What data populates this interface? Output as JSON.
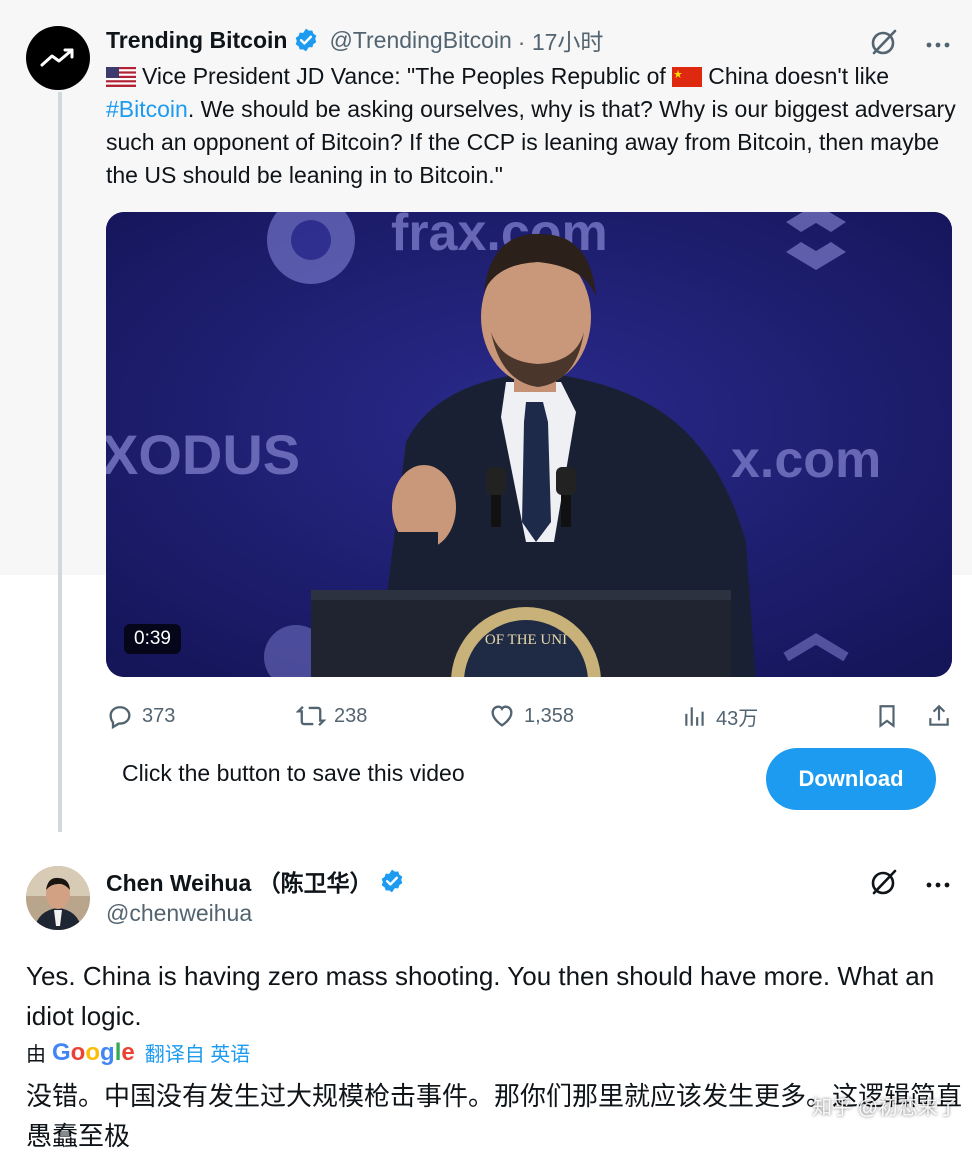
{
  "tweet": {
    "display_name": "Trending Bitcoin",
    "handle": "@TrendingBitcoin",
    "time": "· 17小时",
    "text_part1": "Vice President JD Vance: \"The Peoples Republic of ",
    "text_part2": "China doesn't like ",
    "hashtag": "#Bitcoin",
    "text_part3": ". We should be asking ourselves, why is that? Why is our biggest adversary such an opponent of Bitcoin? If the CCP is leaning away from Bitcoin, then maybe the US should be leaning in to Bitcoin.\"",
    "video_duration": "0:39",
    "video_backdrop": {
      "brand_1": "frax.com",
      "brand_2": "XODUS",
      "brand_3": "x.com",
      "seal_text": "OF THE UNI"
    },
    "actions": {
      "replies": "373",
      "retweets": "238",
      "likes": "1,358",
      "views": "43万"
    }
  },
  "save_bar": {
    "text": "Click the button to save this video",
    "button": "Download"
  },
  "reply": {
    "display_name": "Chen Weihua （陈卫华）",
    "handle": "@chenweihua",
    "text": "Yes. China is having zero mass shooting. You then should have more. What an idiot logic.",
    "translate_by": "由",
    "translate_brand": "Google",
    "translate_link": "翻译自 英语",
    "translated_text": "没错。中国没有发生过大规模枪击事件。那你们那里就应该发生更多。这逻辑简直愚蠢至极"
  },
  "watermark": "知乎 @初恋来了",
  "colors": {
    "accent": "#1d9bf0",
    "muted": "#536471",
    "text": "#0f1419"
  }
}
